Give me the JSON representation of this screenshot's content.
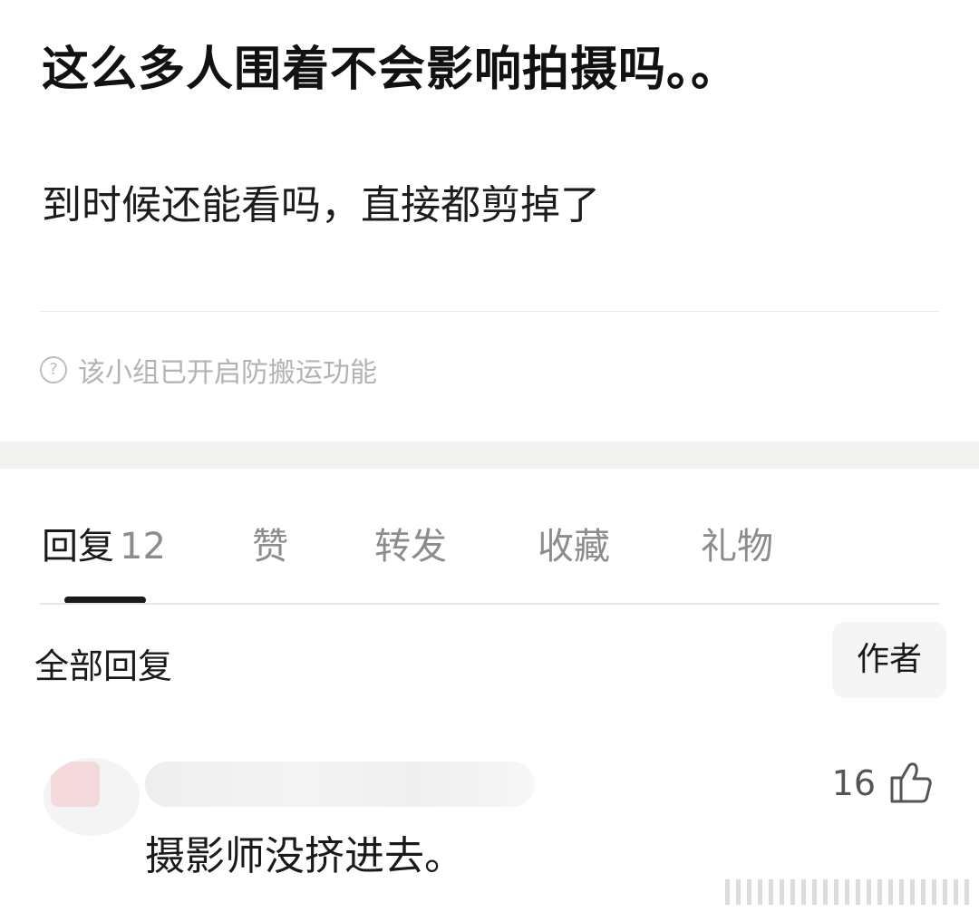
{
  "post": {
    "title": "这么多人围着不会影响拍摄吗。。",
    "body": "到时候还能看吗，直接都剪掉了",
    "notice": "该小组已开启防搬运功能",
    "notice_icon": "question-circle-icon"
  },
  "tabs": [
    {
      "label": "回复",
      "count": "12",
      "active": true
    },
    {
      "label": "赞"
    },
    {
      "label": "转发"
    },
    {
      "label": "收藏"
    },
    {
      "label": "礼物"
    }
  ],
  "filter": {
    "label": "全部回复",
    "author_button": "作者"
  },
  "comments": [
    {
      "like_count": "16",
      "like_icon": "thumbs-up-icon",
      "text": "摄影师没挤进去。"
    }
  ],
  "colors": {
    "band": "#f2f2f0",
    "muted_text": "#8c8c8c",
    "accent": "#1a1a1a"
  }
}
